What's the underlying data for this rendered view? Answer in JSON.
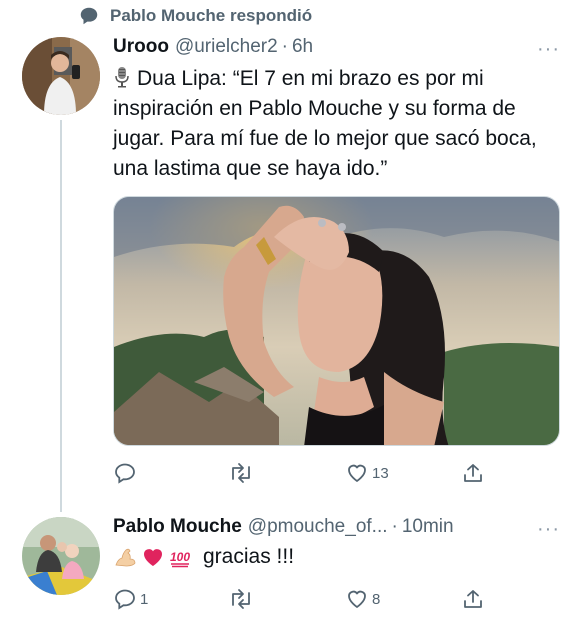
{
  "reply_context": {
    "text": "Pablo Mouche respondió",
    "icon": "speech-bubble-icon"
  },
  "tweets": [
    {
      "author_name": "Urooo",
      "handle": "@urielcher2",
      "separator": "·",
      "time": "6h",
      "more": "···",
      "lead_icon": "microphone-emoji",
      "text": "Dua Lipa: “El 7 en mi brazo es por mi inspiración en Pablo Mouche y su forma de jugar. Para mí fue de lo mejor que sacó boca, una lastima que se haya ido.”",
      "media": "photo of Dua Lipa",
      "actions": {
        "reply": "",
        "retweet": "",
        "like": "13",
        "share": ""
      }
    },
    {
      "author_name": "Pablo Mouche",
      "handle": "@pmouche_of...",
      "separator": "·",
      "time": "10min",
      "more": "···",
      "emojis": [
        "flexed-biceps-emoji",
        "red-heart-emoji",
        "hundred-points-emoji"
      ],
      "text": "gracias !!!",
      "actions": {
        "reply": "1",
        "retweet": "",
        "like": "8",
        "share": ""
      }
    }
  ],
  "colors": {
    "text": "#0f1419",
    "secondary": "#536471",
    "divider": "#cfd9de",
    "heart": "#e0245e"
  }
}
